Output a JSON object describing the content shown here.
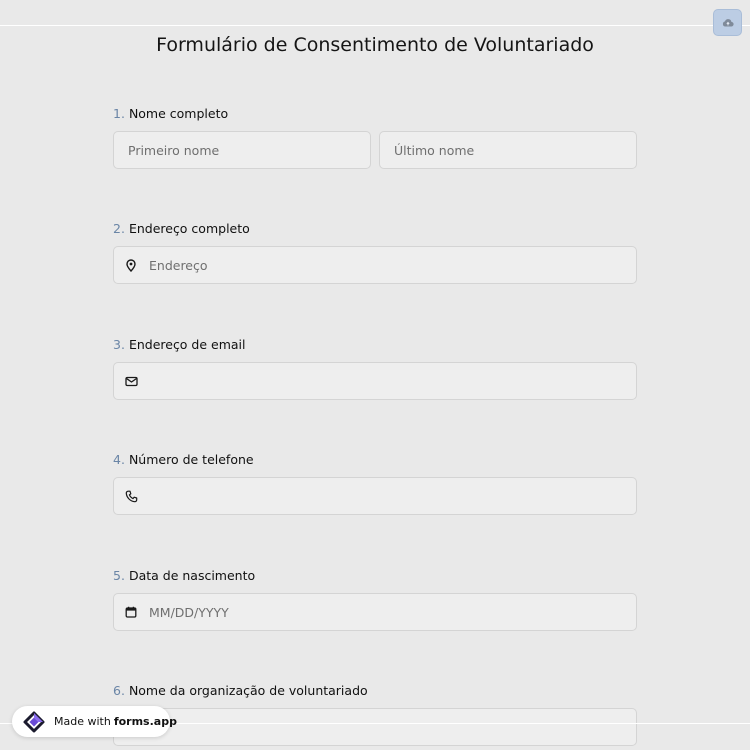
{
  "form": {
    "title": "Formulário de Consentimento de Voluntariado"
  },
  "questions": [
    {
      "number": "1.",
      "label": "Nome completo",
      "first_placeholder": "Primeiro nome",
      "last_placeholder": "Último nome"
    },
    {
      "number": "2.",
      "label": "Endereço completo",
      "placeholder": "Endereço",
      "icon": "map-pin-icon"
    },
    {
      "number": "3.",
      "label": "Endereço de email",
      "placeholder": "",
      "icon": "envelope-icon"
    },
    {
      "number": "4.",
      "label": "Número de telefone",
      "placeholder": "",
      "icon": "phone-icon"
    },
    {
      "number": "5.",
      "label": "Data de nascimento",
      "placeholder": "MM/DD/YYYY",
      "icon": "calendar-icon"
    },
    {
      "number": "6.",
      "label": "Nome da organização de voluntariado",
      "placeholder": ""
    }
  ],
  "badge": {
    "prefix": "Made with",
    "brand": "forms.app"
  },
  "toolbar": {
    "save_icon": "cloud-upload-icon"
  },
  "colors": {
    "background": "#e9e9e9",
    "field_background": "#eeeeee",
    "question_number": "#6a85a6",
    "save_button": "#bccde4",
    "logo_purple": "#6a4bd6"
  }
}
